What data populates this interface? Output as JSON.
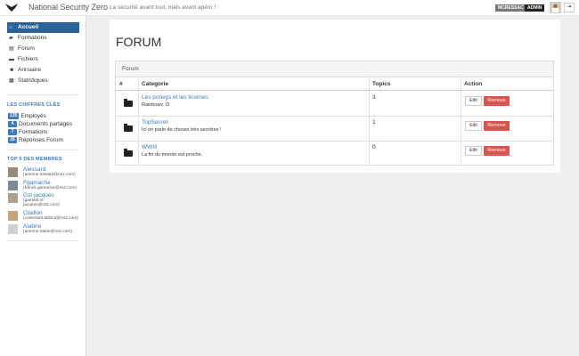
{
  "header": {
    "brand": "National Security Zero",
    "tagline": "La sécurité avant tout, mais avant apéro !",
    "user_badge": "MCRESSAC",
    "role_badge": "ADMIN",
    "logout_glyph": "⇥"
  },
  "sidebar": {
    "nav": [
      {
        "label": "Accueil",
        "icon": "home-icon",
        "glyph": "⌂",
        "active": true
      },
      {
        "label": "Formations",
        "icon": "graduation-cap-icon",
        "glyph": "🎓",
        "active": false
      },
      {
        "label": "Forum",
        "icon": "list-icon",
        "glyph": "▤",
        "active": false
      },
      {
        "label": "Fichiers",
        "icon": "folder-icon",
        "glyph": "▬",
        "active": false
      },
      {
        "label": "Annuaire",
        "icon": "users-icon",
        "glyph": "👥",
        "active": false
      },
      {
        "label": "Statistiques",
        "icon": "chart-icon",
        "glyph": "▦",
        "active": false
      }
    ],
    "stats_title": "LES CHIFFRES CLÉS",
    "stats": [
      {
        "count": "135",
        "label": "Employés"
      },
      {
        "count": "4",
        "label": "Documents partagés"
      },
      {
        "count": "7",
        "label": "Formations"
      },
      {
        "count": "26",
        "label": "Réponses Forum"
      }
    ],
    "members_title": "TOP 5 DES MEMBRES",
    "members": [
      {
        "name": "Alessard",
        "email": "(arienne.lessard@nsz.com)"
      },
      {
        "name": "Fgamache",
        "email": "(franck.gamache@nsz.com)"
      },
      {
        "name": "Gst-jacques",
        "email": "(gaétanl.st-",
        "email2": "jacques@nsz.com)"
      },
      {
        "name": "Ctaillon",
        "email": "(coelesant.tallond@nsz.com)"
      },
      {
        "name": "Alabrie",
        "email": "(arienne.labrie@nsz.com)"
      }
    ]
  },
  "main": {
    "title": "FORUM",
    "panel_title": "Forum",
    "columns": [
      "#",
      "Categorie",
      "Topics",
      "Action"
    ],
    "rows": [
      {
        "name": "Les poneys et les licornes",
        "desc": "Rainbows :D",
        "topics": "3"
      },
      {
        "name": "TopSecret",
        "desc": "Ici on parle de choses très secrètes !",
        "topics": "1"
      },
      {
        "name": "WWIII",
        "desc": "La fin du monde est proche.",
        "topics": "0"
      }
    ],
    "edit_label": "Edit",
    "remove_label": "Remove"
  },
  "colors": {
    "accent": "#2a6496",
    "link": "#3a7bbf",
    "danger": "#d9534f"
  }
}
